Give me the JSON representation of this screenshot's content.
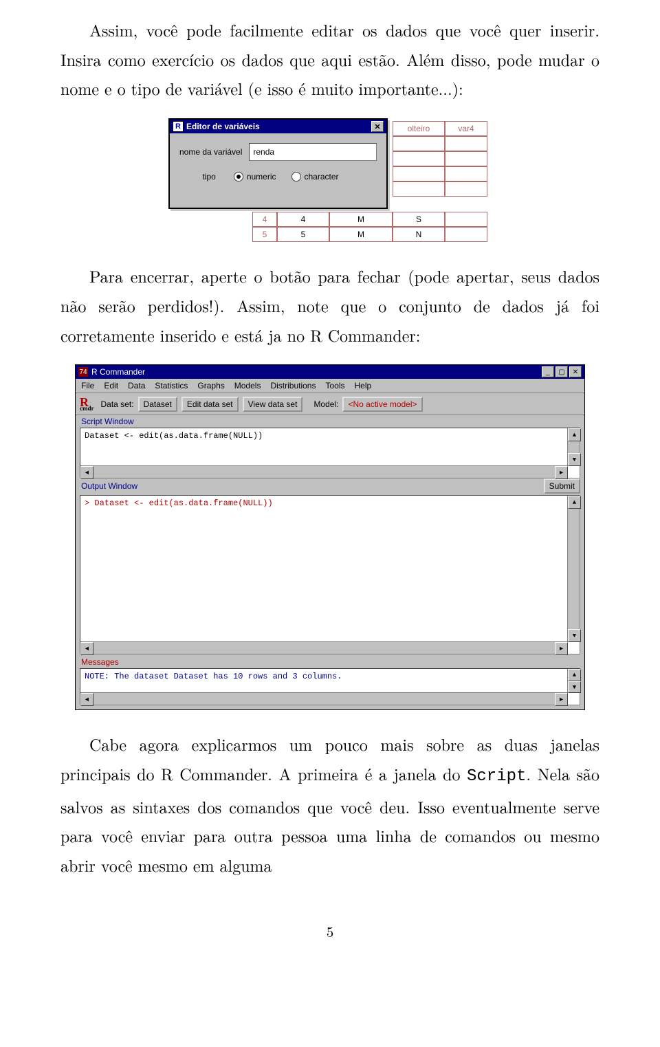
{
  "para1": "Assim, você pode facilmente editar os dados que você quer inserir. Insira como exercício os dados que aqui estão. Além disso, pode mudar o nome e o tipo de variável (e isso é muito importante...):",
  "para2": "Para encerrar, aperte o botão para fechar (pode apertar, seus dados não serão perdidos!). Assim, note que o conjunto de dados já foi corretamente inserido e está ja no R Commander:",
  "para3_a": "Cabe agora explicarmos um pouco mais sobre as duas janelas principais do R Commander. A primeira é a janela do ",
  "para3_mono": "Script",
  "para3_b": ". Nela são salvos as sintaxes dos comandos que você deu. Isso eventualmente serve para você enviar para outra pessoa uma linha de comandos ou mesmo abrir você mesmo em alguma",
  "editor": {
    "title": "Editor de variáveis",
    "icon": "R",
    "lbl_name": "nome da variável",
    "value": "renda",
    "lbl_tipo": "tipo",
    "opt_numeric": "numeric",
    "opt_character": "character",
    "grid_h1": "olteiro",
    "grid_h2": "var4",
    "grid_r1a": "4",
    "grid_r1b": "4",
    "grid_r1c": "M",
    "grid_r1d": "S",
    "grid_r2a": "5",
    "grid_r2b": "5",
    "grid_r2c": "M",
    "grid_r2d": "N"
  },
  "rc": {
    "title": "R Commander",
    "menu": [
      "File",
      "Edit",
      "Data",
      "Statistics",
      "Graphs",
      "Models",
      "Distributions",
      "Tools",
      "Help"
    ],
    "toolbar": {
      "dataset_label": "Data set:",
      "dataset_btn": "Dataset",
      "edit_btn": "Edit data set",
      "view_btn": "View data set",
      "model_label": "Model:",
      "model_value": "<No active model>"
    },
    "script_label": "Script Window",
    "script_content": "Dataset <- edit(as.data.frame(NULL))",
    "output_label": "Output Window",
    "submit": "Submit",
    "output_prompt_color": "#b00000",
    "output_content": "> Dataset <- edit(as.data.frame(NULL))",
    "messages_label": "Messages",
    "messages_content": "NOTE: The dataset Dataset has 10 rows and 3 columns."
  },
  "pagenum": "5"
}
